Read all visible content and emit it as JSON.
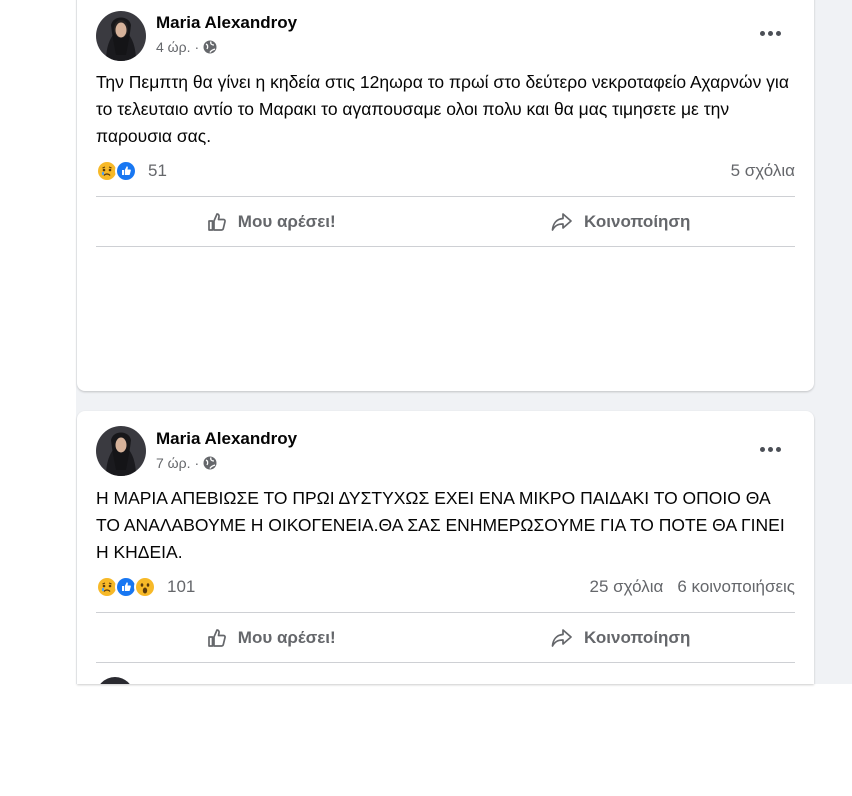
{
  "posts": [
    {
      "author": "Maria Alexandroy",
      "time": "4 ώρ.",
      "dot": "·",
      "text": "Την Πεμπτη θα γίνει η κηδεία στις 12ηωρα το πρωί στο δεύτερο νεκροταφείο Αχαρνών για το τελευταιο αντίο το Μαρακι το αγαπουσαμε ολοι πολυ και θα μας τιμησετε με την παρουσια σας.",
      "reaction_count": "51",
      "comments": "5 σχόλια",
      "shares": "",
      "reactions": [
        "sad",
        "like"
      ]
    },
    {
      "author": "Maria Alexandroy",
      "time": "7 ώρ.",
      "dot": "·",
      "text": "Η ΜΑΡΙΑ ΑΠΕΒΙΩΣΕ ΤΟ ΠΡΩΙ ΔΥΣΤΥΧΩΣ ΕΧΕΙ ΕΝΑ ΜΙΚΡΟ ΠΑΙΔΑΚΙ ΤΟ ΟΠΟΙΟ ΘΑ ΤΟ ΑΝΑΛΑΒΟΥΜΕ Η ΟΙΚΟΓΕΝΕΙΑ.ΘΑ ΣΑΣ ΕΝΗΜΕΡΩΣΟΥΜΕ ΓΙΑ ΤΟ ΠΟΤΕ ΘΑ ΓΙΝΕΙ Η ΚΗΔΕΙΑ.",
      "reaction_count": "101",
      "comments": "25 σχόλια",
      "shares": "6 κοινοποιήσεις",
      "reactions": [
        "sad",
        "like",
        "wow"
      ]
    }
  ],
  "actions": {
    "like_label": "Μου αρέσει!",
    "share_label": "Κοινοποίηση"
  },
  "colors": {
    "feed_background": "#f0f2f5",
    "secondary_text": "#65676b",
    "like_blue": "#1877f2",
    "reaction_yellow": "#f7b928"
  }
}
